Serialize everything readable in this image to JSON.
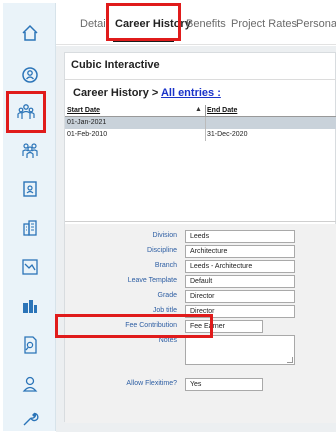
{
  "sidebar": {
    "items": [
      {
        "icon": "home-icon"
      },
      {
        "icon": "search-person-icon"
      },
      {
        "icon": "people-group-icon"
      },
      {
        "icon": "team-icon"
      },
      {
        "icon": "contact-card-icon"
      },
      {
        "icon": "buildings-icon"
      },
      {
        "icon": "chart-icon"
      },
      {
        "icon": "city-icon"
      },
      {
        "icon": "document-search-icon"
      },
      {
        "icon": "user-badge-icon"
      },
      {
        "icon": "wrench-icon"
      }
    ],
    "active_index": 2
  },
  "tabs": [
    {
      "label": "Detail"
    },
    {
      "label": "Career History"
    },
    {
      "label": "Benefits"
    },
    {
      "label": "Project Rates"
    },
    {
      "label": "Personal"
    }
  ],
  "active_tab": "Career History",
  "company_name": "Cubic Interactive",
  "career_history": {
    "title_prefix": "Career History > ",
    "title_link": "All entries :",
    "columns": [
      "Start Date",
      "End Date"
    ],
    "rows": [
      {
        "start": "01-Jan-2021",
        "end": ""
      },
      {
        "start": "01-Feb-2010",
        "end": "31-Dec-2020"
      }
    ]
  },
  "form": {
    "division": {
      "label": "Division",
      "value": "Leeds"
    },
    "discipline": {
      "label": "Discipline",
      "value": "Architecture"
    },
    "branch": {
      "label": "Branch",
      "value": "Leeds - Architecture"
    },
    "leave_template": {
      "label": "Leave Template",
      "value": "Default"
    },
    "grade": {
      "label": "Grade",
      "value": "Director"
    },
    "job_title": {
      "label": "Job title",
      "value": "Director"
    },
    "fee_contribution": {
      "label": "Fee Contribution",
      "value": "Fee Earner"
    },
    "notes": {
      "label": "Notes",
      "value": ""
    },
    "allow_flexitime": {
      "label": "Allow Flexitime?",
      "value": "Yes"
    }
  },
  "colors": {
    "accent_red": "#e01b1b",
    "link_blue": "#1a33c9",
    "label_blue": "#2d5ea3",
    "sidebar_bg": "#eaf3f9",
    "icon_blue": "#2b74b8"
  }
}
